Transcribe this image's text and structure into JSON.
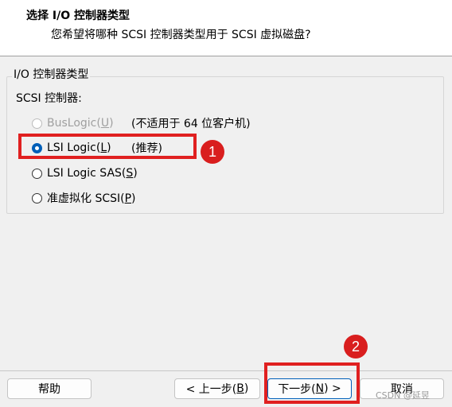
{
  "header": {
    "title": "选择 I/O 控制器类型",
    "subtitle": "您希望将哪种 SCSI 控制器类型用于 SCSI 虚拟磁盘?"
  },
  "group": {
    "legend": "I/O 控制器类型",
    "label": "SCSI 控制器:"
  },
  "options": [
    {
      "text": "BusLogic(",
      "mnemonic": "U",
      "suffix": ")",
      "note": "(不适用于 64 位客户机)",
      "checked": false,
      "disabled": true
    },
    {
      "text": "LSI Logic(",
      "mnemonic": "L",
      "suffix": ")",
      "note": "(推荐)",
      "checked": true,
      "disabled": false
    },
    {
      "text": "LSI Logic SAS(",
      "mnemonic": "S",
      "suffix": ")",
      "note": "",
      "checked": false,
      "disabled": false
    },
    {
      "text": "准虚拟化 SCSI(",
      "mnemonic": "P",
      "suffix": ")",
      "note": "",
      "checked": false,
      "disabled": false
    }
  ],
  "buttons": {
    "help": "帮助",
    "back_text": "< 上一步(",
    "back_mnemonic": "B",
    "back_suffix": ")",
    "next_text": "下一步(",
    "next_mnemonic": "N",
    "next_suffix": ") >",
    "cancel": "取消"
  },
  "annotations": {
    "badge_1": "1",
    "badge_2": "2",
    "color": "#e02020"
  },
  "watermark": "CSDN @延昱",
  "colors": {
    "accent": "#005fb8",
    "background": "#f0f0f0"
  }
}
